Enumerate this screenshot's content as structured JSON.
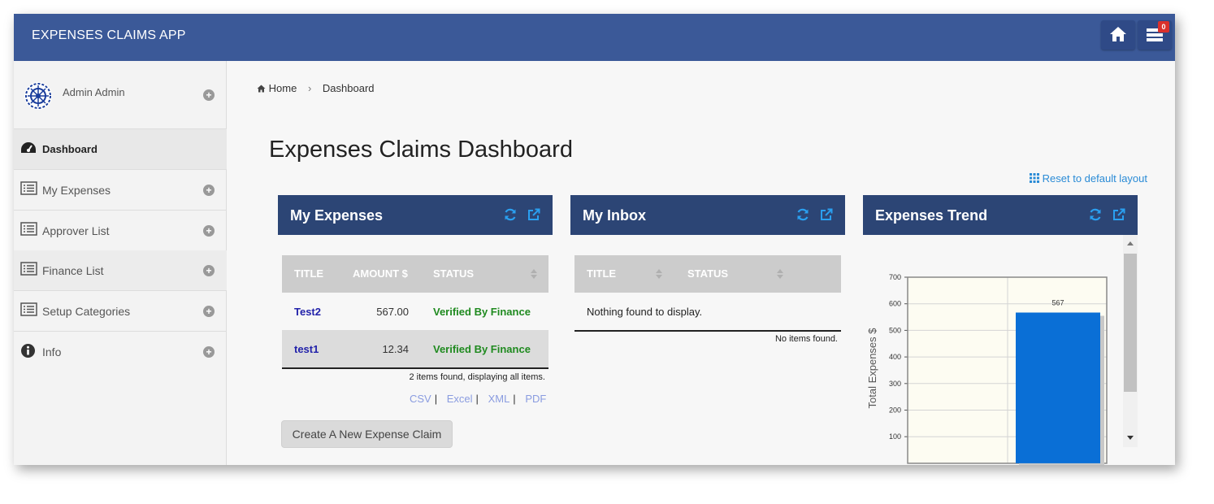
{
  "app": {
    "title": "EXPENSES CLAIMS APP",
    "notification_count": "0"
  },
  "sidebar": {
    "user_name": "Admin Admin",
    "items": [
      {
        "label": "Dashboard",
        "icon": "dashboard-icon"
      },
      {
        "label": "My Expenses",
        "icon": "list-icon"
      },
      {
        "label": "Approver List",
        "icon": "list-icon"
      },
      {
        "label": "Finance List",
        "icon": "list-icon"
      },
      {
        "label": "Setup Categories",
        "icon": "list-icon"
      },
      {
        "label": "Info",
        "icon": "info-icon"
      }
    ]
  },
  "breadcrumb": {
    "home": "Home",
    "current": "Dashboard"
  },
  "page": {
    "title": "Expenses Claims Dashboard",
    "reset_link": "Reset to default layout"
  },
  "panels": {
    "my_expenses": {
      "title": "My Expenses",
      "columns": [
        "TITLE",
        "AMOUNT $",
        "STATUS"
      ],
      "rows": [
        {
          "title": "Test2",
          "amount": "567.00",
          "status": "Verified By Finance"
        },
        {
          "title": "test1",
          "amount": "12.34",
          "status": "Verified By Finance"
        }
      ],
      "summary": "2 items found, displaying all items.",
      "exports": [
        "CSV",
        "Excel",
        "XML",
        "PDF"
      ],
      "new_button": "Create A New Expense Claim"
    },
    "my_inbox": {
      "title": "My Inbox",
      "columns": [
        "TITLE",
        "STATUS"
      ],
      "empty_message": "Nothing found to display.",
      "summary": "No items found."
    },
    "expenses_trend": {
      "title": "Expenses Trend"
    }
  },
  "colors": {
    "topbar": "#3b5998",
    "panel_header": "#2c4575",
    "bar": "#0a6fd6",
    "status_ok": "#1f8a1f"
  },
  "chart_data": {
    "type": "bar",
    "categories": [
      ""
    ],
    "values": [
      567
    ],
    "data_labels": [
      "567"
    ],
    "ylabel": "Total Expenses $",
    "yticks": [
      100,
      200,
      300,
      400,
      500,
      600,
      700
    ],
    "ylim": [
      0,
      700
    ],
    "grid": true
  }
}
